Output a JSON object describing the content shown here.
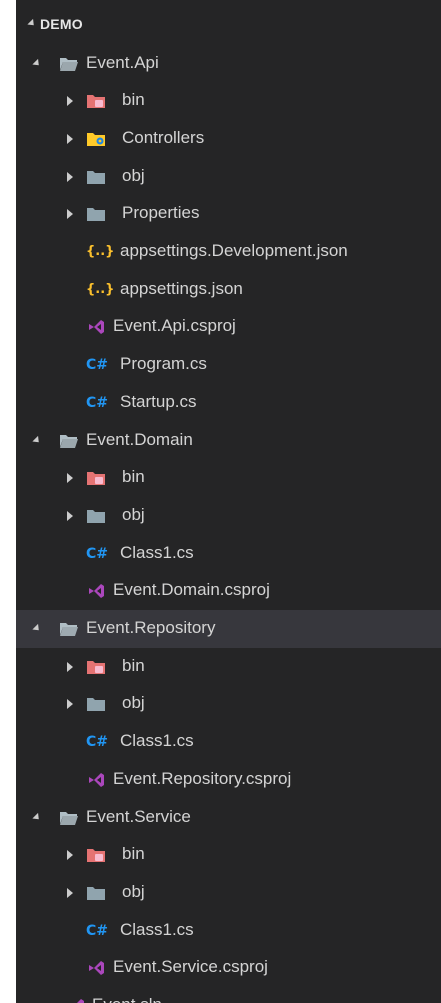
{
  "explorer": {
    "section_title": "DEMO",
    "items": [
      {
        "label": "Event.Api",
        "kind": "folder-open",
        "depth": 0,
        "twistie": "expanded"
      },
      {
        "label": "bin",
        "kind": "folder-bin",
        "depth": 1,
        "twistie": "collapsed"
      },
      {
        "label": "Controllers",
        "kind": "folder-controllers",
        "depth": 1,
        "twistie": "collapsed"
      },
      {
        "label": "obj",
        "kind": "folder",
        "depth": 1,
        "twistie": "collapsed"
      },
      {
        "label": "Properties",
        "kind": "folder",
        "depth": 1,
        "twistie": "collapsed"
      },
      {
        "label": "appsettings.Development.json",
        "kind": "json",
        "depth": 1,
        "twistie": "none"
      },
      {
        "label": "appsettings.json",
        "kind": "json",
        "depth": 1,
        "twistie": "none"
      },
      {
        "label": "Event.Api.csproj",
        "kind": "csproj",
        "depth": 1,
        "twistie": "none"
      },
      {
        "label": "Program.cs",
        "kind": "csharp",
        "depth": 1,
        "twistie": "none"
      },
      {
        "label": "Startup.cs",
        "kind": "csharp",
        "depth": 1,
        "twistie": "none"
      },
      {
        "label": "Event.Domain",
        "kind": "folder-open",
        "depth": 0,
        "twistie": "expanded"
      },
      {
        "label": "bin",
        "kind": "folder-bin",
        "depth": 1,
        "twistie": "collapsed"
      },
      {
        "label": "obj",
        "kind": "folder",
        "depth": 1,
        "twistie": "collapsed"
      },
      {
        "label": "Class1.cs",
        "kind": "csharp",
        "depth": 1,
        "twistie": "none"
      },
      {
        "label": "Event.Domain.csproj",
        "kind": "csproj",
        "depth": 1,
        "twistie": "none"
      },
      {
        "label": "Event.Repository",
        "kind": "folder-open",
        "depth": 0,
        "twistie": "expanded",
        "selected": true
      },
      {
        "label": "bin",
        "kind": "folder-bin",
        "depth": 1,
        "twistie": "collapsed"
      },
      {
        "label": "obj",
        "kind": "folder",
        "depth": 1,
        "twistie": "collapsed"
      },
      {
        "label": "Class1.cs",
        "kind": "csharp",
        "depth": 1,
        "twistie": "none"
      },
      {
        "label": "Event.Repository.csproj",
        "kind": "csproj",
        "depth": 1,
        "twistie": "none"
      },
      {
        "label": "Event.Service",
        "kind": "folder-open",
        "depth": 0,
        "twistie": "expanded"
      },
      {
        "label": "bin",
        "kind": "folder-bin",
        "depth": 1,
        "twistie": "collapsed"
      },
      {
        "label": "obj",
        "kind": "folder",
        "depth": 1,
        "twistie": "collapsed"
      },
      {
        "label": "Class1.cs",
        "kind": "csharp",
        "depth": 1,
        "twistie": "none"
      },
      {
        "label": "Event.Service.csproj",
        "kind": "csproj",
        "depth": 1,
        "twistie": "none"
      },
      {
        "label": "Event.sln",
        "kind": "csproj",
        "depth": 0,
        "twistie": "none"
      }
    ]
  },
  "icons": {
    "json_glyph": "{..}",
    "csharp_glyph": "C#"
  },
  "colors": {
    "background": "#252526",
    "selected_row": "#37373d",
    "text": "#d4d4d4",
    "folder": "#90a4ae",
    "folder_open": "#b0bec5",
    "folder_bin": "#e57373",
    "folder_controllers": "#ffca28",
    "json": "#fbc02d",
    "csharp": "#2196f3",
    "csproj": "#ab47bc"
  }
}
